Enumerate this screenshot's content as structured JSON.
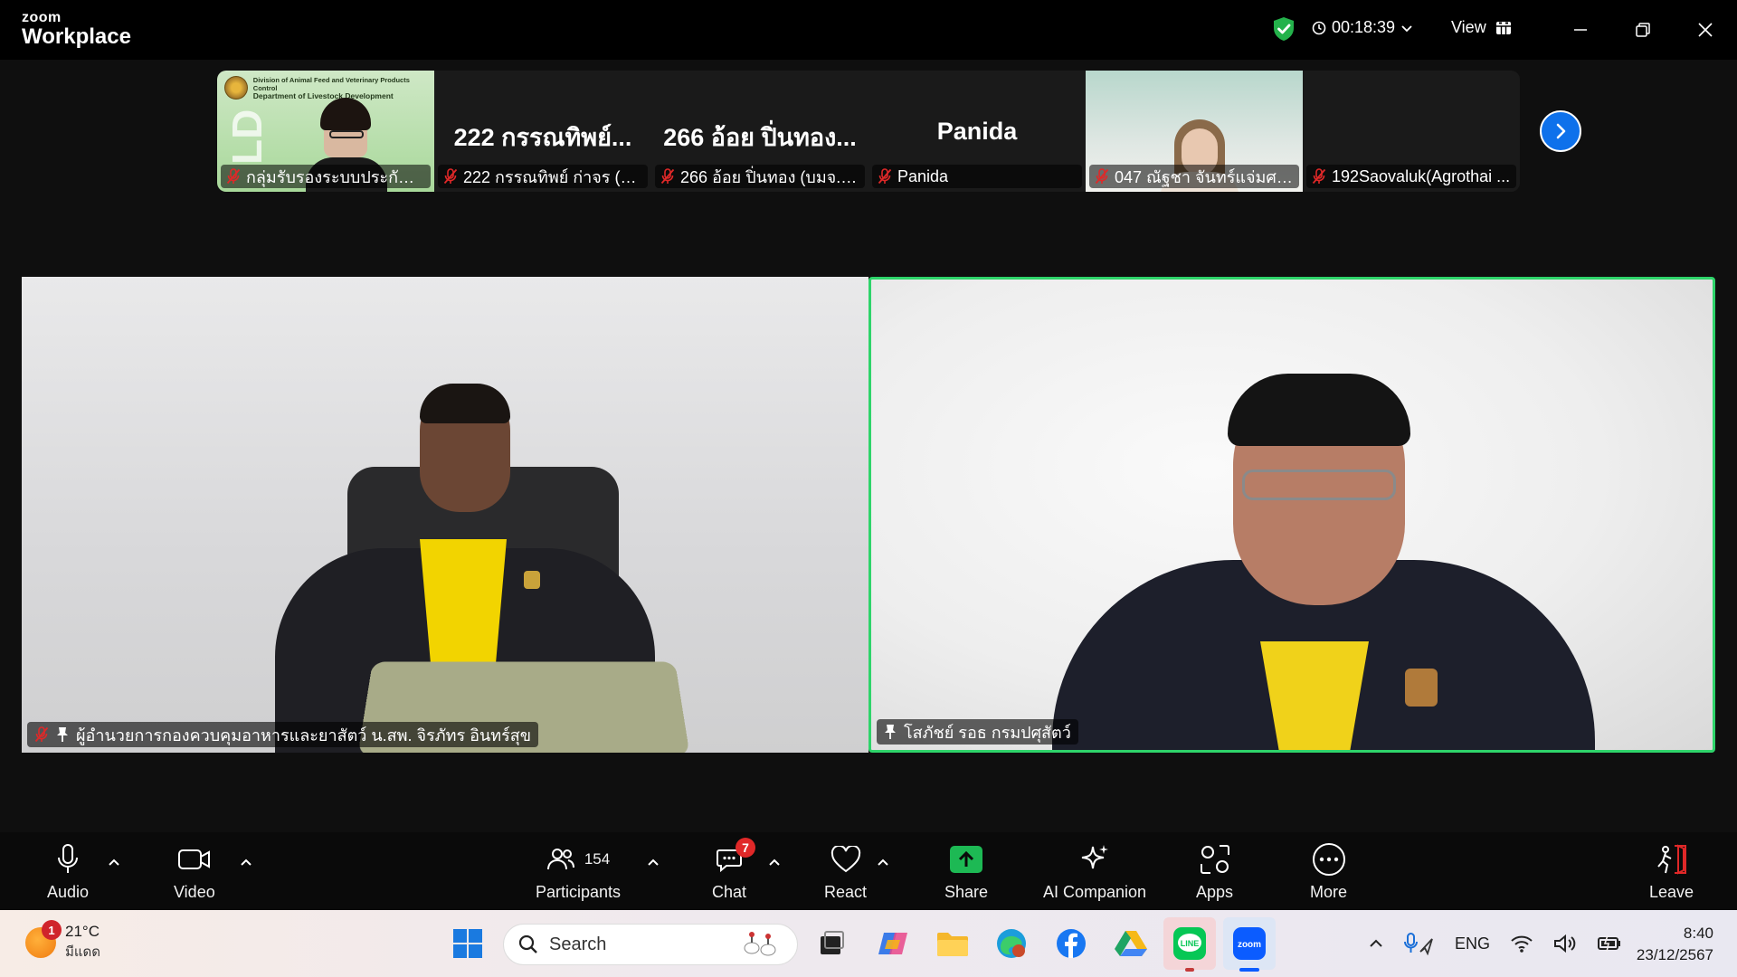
{
  "window": {
    "brand_small": "zoom",
    "brand_large": "Workplace",
    "timer": "00:18:39",
    "view_label": "View"
  },
  "thumbnails": [
    {
      "type": "video",
      "label": "กลุ่มรับรองระบบประกันคุณ...",
      "header_line1": "Division of Animal Feed and Veterinary Products Control",
      "header_line2": "Department of Livestock Development",
      "muted": true
    },
    {
      "type": "name",
      "big_name": "222 กรรณทิพย์...",
      "label": "222 กรรณทิพย์  ก่าจร (พี...",
      "muted": true
    },
    {
      "type": "name",
      "big_name": "266 อ้อย ปิ่นทอง...",
      "label": "266 อ้อย ปิ่นทอง (บมจ.เจริ...",
      "muted": true
    },
    {
      "type": "name",
      "big_name": "Panida",
      "label": "Panida",
      "muted": true
    },
    {
      "type": "video",
      "label": "047 ณัฐชา จันทร์แจ่มศรี เ...",
      "muted": true
    },
    {
      "type": "name",
      "big_name": "",
      "label": "192Saovaluk(Agrothai ...",
      "muted": true
    }
  ],
  "videos": {
    "left": {
      "label": "ผู้อำนวยการกองควบคุมอาหารและยาสัตว์ น.สพ. จิรภัทร อินทร์สุข",
      "muted": true,
      "pinned": true
    },
    "right": {
      "label": "โสภัชย์ รอธ กรมปศุสัตว์",
      "muted": false,
      "pinned": true,
      "active_speaker_color": "#2ed46a"
    }
  },
  "controls": {
    "audio": "Audio",
    "video": "Video",
    "participants": "Participants",
    "participants_count": "154",
    "chat": "Chat",
    "chat_badge": "7",
    "react": "React",
    "share": "Share",
    "ai_companion": "AI Companion",
    "apps": "Apps",
    "more": "More",
    "leave": "Leave"
  },
  "taskbar": {
    "weather_temp": "21°C",
    "weather_condition": "มีแดด",
    "weather_badge": "1",
    "search_placeholder": "Search",
    "language": "ENG",
    "time": "8:40",
    "date": "23/12/2567"
  },
  "colors": {
    "accent_blue": "#0e71eb",
    "share_green": "#1db954",
    "mute_red": "#e02828",
    "speaker_border": "#2ed46a"
  }
}
